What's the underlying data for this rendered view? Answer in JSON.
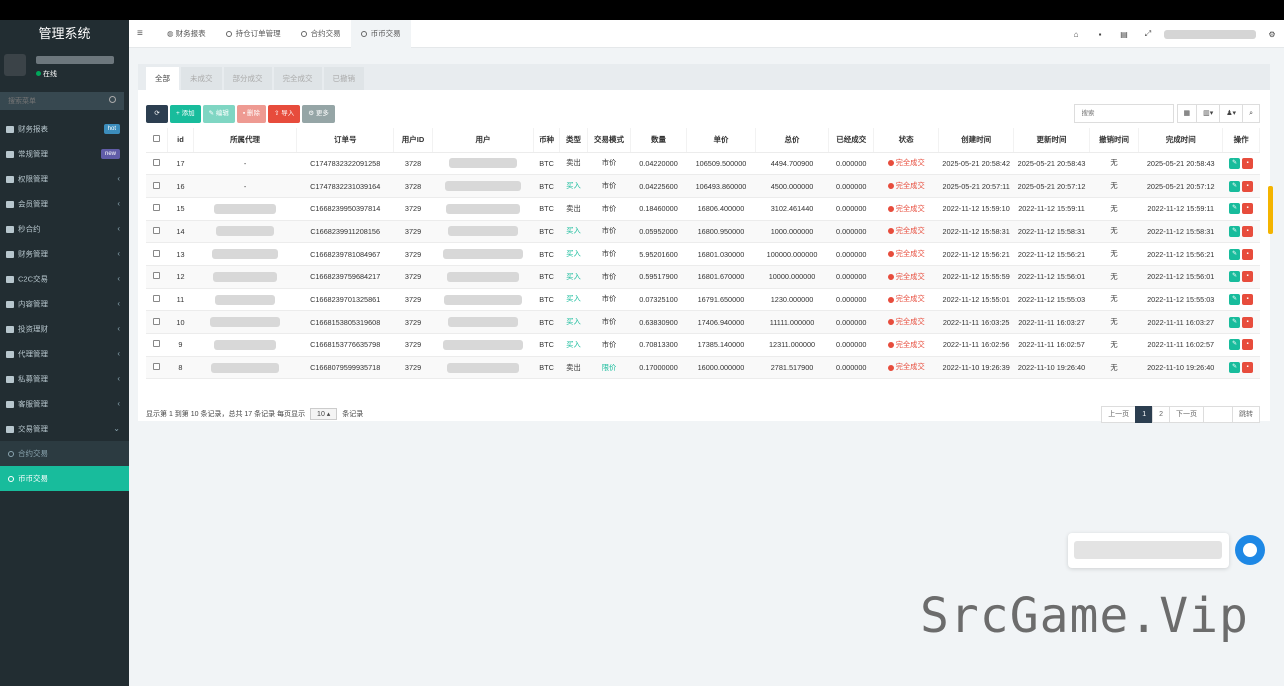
{
  "app": {
    "title": "管理系统",
    "status": "在线"
  },
  "sidebar": {
    "search_placeholder": "搜索菜单",
    "items": [
      {
        "label": "财务报表",
        "badge": "hot"
      },
      {
        "label": "常规管理",
        "badge": "new"
      },
      {
        "label": "权限管理",
        "chevron": "‹"
      },
      {
        "label": "会员管理",
        "chevron": "‹"
      },
      {
        "label": "秒合约",
        "chevron": "‹"
      },
      {
        "label": "财务管理",
        "chevron": "‹"
      },
      {
        "label": "C2C交易",
        "chevron": "‹"
      },
      {
        "label": "内容管理",
        "chevron": "‹"
      },
      {
        "label": "投资理财",
        "chevron": "‹"
      },
      {
        "label": "代理管理",
        "chevron": "‹"
      },
      {
        "label": "私募管理",
        "chevron": "‹"
      },
      {
        "label": "客服管理",
        "chevron": "‹"
      },
      {
        "label": "交易管理",
        "chevron": "⌄"
      }
    ],
    "subitems": [
      {
        "label": "合约交易"
      },
      {
        "label": "币币交易"
      }
    ]
  },
  "topbar": {
    "tabs": [
      "财务报表",
      "持仓订单管理",
      "合约交易",
      "币币交易"
    ]
  },
  "panel": {
    "tabs": [
      "全部",
      "未成交",
      "部分成交",
      "完全成交",
      "已撤销"
    ],
    "toolbar": {
      "add": "添加",
      "edit": "编辑",
      "delete": "删除",
      "import": "导入",
      "more": "更多"
    },
    "search_placeholder": "搜索"
  },
  "table": {
    "headers": [
      "id",
      "所属代理",
      "订单号",
      "用户ID",
      "用户",
      "币种",
      "类型",
      "交易模式",
      "数量",
      "单价",
      "总价",
      "已经成交",
      "状态",
      "创建时间",
      "更新时间",
      "撤销时间",
      "完成时间",
      "操作"
    ],
    "rows": [
      {
        "id": "17",
        "agent": "-",
        "order": "C1747832322091258",
        "uid": "3728",
        "coin": "BTC",
        "type": "卖出",
        "mode": "市价",
        "qty": "0.04220000",
        "price": "106509.500000",
        "total": "4494.700900",
        "done": "0.000000",
        "status": "完全成交",
        "created": "2025-05-21 20:58:42",
        "updated": "2025-05-21 20:58:43",
        "cancel": "无",
        "finished": "2025-05-21 20:58:43"
      },
      {
        "id": "16",
        "agent": "-",
        "order": "C1747832231039164",
        "uid": "3728",
        "coin": "BTC",
        "type": "买入",
        "mode": "市价",
        "qty": "0.04225600",
        "price": "106493.860000",
        "total": "4500.000000",
        "done": "0.000000",
        "status": "完全成交",
        "created": "2025-05-21 20:57:11",
        "updated": "2025-05-21 20:57:12",
        "cancel": "无",
        "finished": "2025-05-21 20:57:12"
      },
      {
        "id": "15",
        "agent": "",
        "order": "C1668239950397814",
        "uid": "3729",
        "coin": "BTC",
        "type": "卖出",
        "mode": "市价",
        "qty": "0.18460000",
        "price": "16806.400000",
        "total": "3102.461440",
        "done": "0.000000",
        "status": "完全成交",
        "created": "2022-11-12 15:59:10",
        "updated": "2022-11-12 15:59:11",
        "cancel": "无",
        "finished": "2022-11-12 15:59:11"
      },
      {
        "id": "14",
        "agent": "",
        "order": "C1668239911208156",
        "uid": "3729",
        "coin": "BTC",
        "type": "买入",
        "mode": "市价",
        "qty": "0.05952000",
        "price": "16800.950000",
        "total": "1000.000000",
        "done": "0.000000",
        "status": "完全成交",
        "created": "2022-11-12 15:58:31",
        "updated": "2022-11-12 15:58:31",
        "cancel": "无",
        "finished": "2022-11-12 15:58:31"
      },
      {
        "id": "13",
        "agent": "",
        "order": "C1668239781084967",
        "uid": "3729",
        "coin": "BTC",
        "type": "买入",
        "mode": "市价",
        "qty": "5.95201600",
        "price": "16801.030000",
        "total": "100000.000000",
        "done": "0.000000",
        "status": "完全成交",
        "created": "2022-11-12 15:56:21",
        "updated": "2022-11-12 15:56:21",
        "cancel": "无",
        "finished": "2022-11-12 15:56:21"
      },
      {
        "id": "12",
        "agent": "",
        "order": "C1668239759684217",
        "uid": "3729",
        "coin": "BTC",
        "type": "买入",
        "mode": "市价",
        "qty": "0.59517900",
        "price": "16801.670000",
        "total": "10000.000000",
        "done": "0.000000",
        "status": "完全成交",
        "created": "2022-11-12 15:55:59",
        "updated": "2022-11-12 15:56:01",
        "cancel": "无",
        "finished": "2022-11-12 15:56:01"
      },
      {
        "id": "11",
        "agent": "",
        "order": "C1668239701325861",
        "uid": "3729",
        "coin": "BTC",
        "type": "买入",
        "mode": "市价",
        "qty": "0.07325100",
        "price": "16791.650000",
        "total": "1230.000000",
        "done": "0.000000",
        "status": "完全成交",
        "created": "2022-11-12 15:55:01",
        "updated": "2022-11-12 15:55:03",
        "cancel": "无",
        "finished": "2022-11-12 15:55:03"
      },
      {
        "id": "10",
        "agent": "",
        "order": "C1668153805319608",
        "uid": "3729",
        "coin": "BTC",
        "type": "买入",
        "mode": "市价",
        "qty": "0.63830900",
        "price": "17406.940000",
        "total": "11111.000000",
        "done": "0.000000",
        "status": "完全成交",
        "created": "2022-11-11 16:03:25",
        "updated": "2022-11-11 16:03:27",
        "cancel": "无",
        "finished": "2022-11-11 16:03:27"
      },
      {
        "id": "9",
        "agent": "",
        "order": "C1668153776635798",
        "uid": "3729",
        "coin": "BTC",
        "type": "买入",
        "mode": "市价",
        "qty": "0.70813300",
        "price": "17385.140000",
        "total": "12311.000000",
        "done": "0.000000",
        "status": "完全成交",
        "created": "2022-11-11 16:02:56",
        "updated": "2022-11-11 16:02:57",
        "cancel": "无",
        "finished": "2022-11-11 16:02:57"
      },
      {
        "id": "8",
        "agent": "",
        "order": "C1668079599935718",
        "uid": "3729",
        "coin": "BTC",
        "type": "卖出",
        "mode": "限价",
        "qty": "0.17000000",
        "price": "16000.000000",
        "total": "2781.517900",
        "done": "0.000000",
        "status": "完全成交",
        "created": "2022-11-10 19:26:39",
        "updated": "2022-11-10 19:26:40",
        "cancel": "无",
        "finished": "2022-11-10 19:26:40"
      }
    ]
  },
  "pagination": {
    "info_prefix": "显示第 1 到第 10 条记录，总共 17 条记录 每页显示",
    "page_size": "10 ▴",
    "info_suffix": "条记录",
    "prev": "上一页",
    "pages": [
      "1",
      "2"
    ],
    "next": "下一页",
    "jump": "跳转"
  },
  "watermark": "SrcGame.Vip",
  "colors": {
    "sidebar_bg": "#222d32",
    "accent": "#18bc9c",
    "danger": "#e74c3c",
    "dark": "#2c3e50"
  }
}
